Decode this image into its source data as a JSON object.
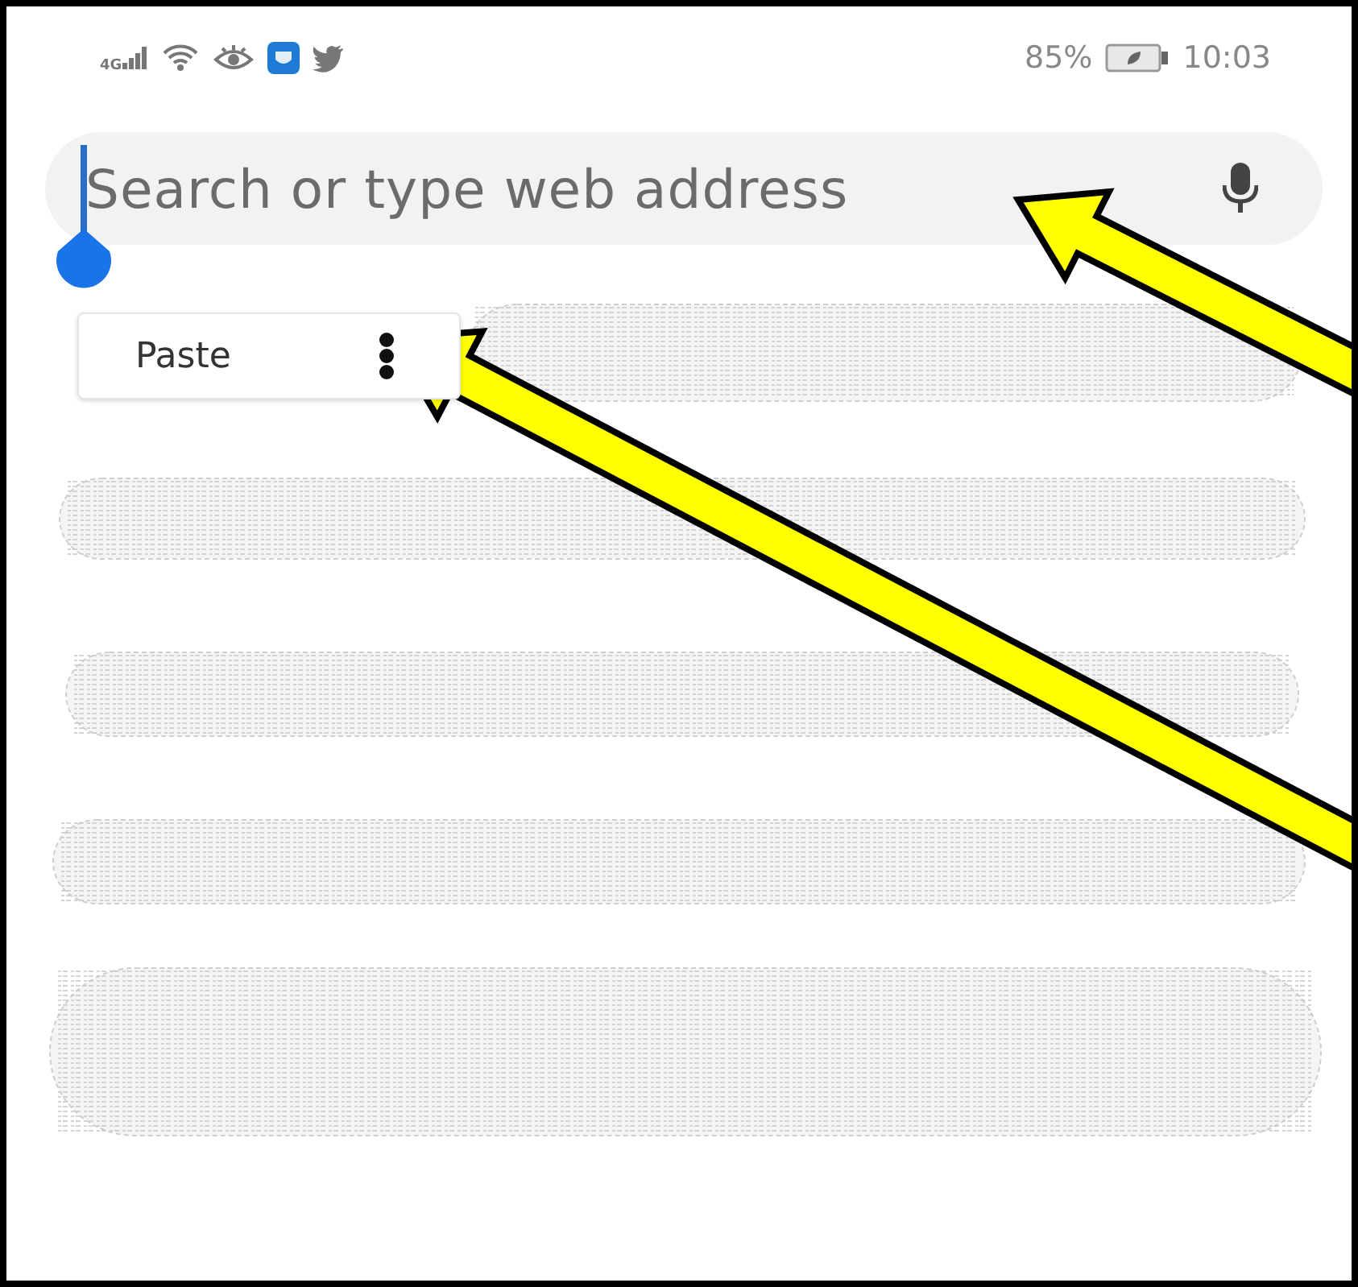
{
  "status_bar": {
    "network": "4G",
    "battery": "85%",
    "time": "10:03"
  },
  "search": {
    "placeholder": "Search or type web address"
  },
  "context_menu": {
    "items": [
      "Paste"
    ]
  },
  "rows": [
    {
      "kind": "scribble"
    },
    {
      "kind": "scribble"
    },
    {
      "kind": "scribble"
    },
    {
      "kind": "scribble"
    },
    {
      "kind": "scribble"
    }
  ],
  "annotations": [
    {
      "kind": "arrow"
    },
    {
      "kind": "arrow"
    }
  ]
}
